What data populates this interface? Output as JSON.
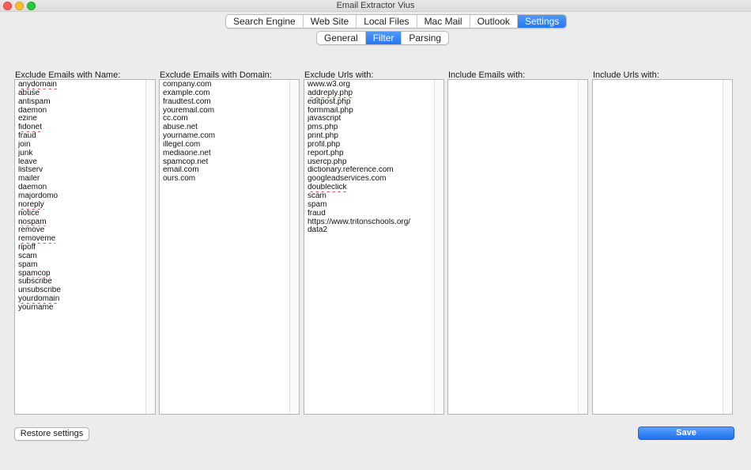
{
  "window": {
    "title": "Email Extractor Vius"
  },
  "main_tabs": [
    {
      "label": "Search Engine",
      "active": false
    },
    {
      "label": "Web Site",
      "active": false
    },
    {
      "label": "Local Files",
      "active": false
    },
    {
      "label": "Mac Mail",
      "active": false
    },
    {
      "label": "Outlook",
      "active": false
    },
    {
      "label": "Settings",
      "active": true
    }
  ],
  "sub_tabs": [
    {
      "label": "General",
      "active": false
    },
    {
      "label": "Filter",
      "active": true
    },
    {
      "label": "Parsing",
      "active": false
    }
  ],
  "columns": [
    {
      "label": "Exclude Emails with Name:",
      "items": [
        "anydomain",
        "abuse",
        "antispam",
        "daemon",
        "ezine",
        "fidonet",
        "fraud",
        "join",
        "junk",
        "leave",
        "listserv",
        "mailer",
        "daemon",
        "majordomo",
        "noreply",
        "notice",
        "nospam",
        "remove",
        "removeme",
        "ripoff",
        "scam",
        "spam",
        "spamcop",
        "subscribe",
        "unsubscribe",
        "yourdomain",
        "yourname"
      ],
      "spell_flagged": [
        "anydomain",
        "fidonet",
        "noreply",
        "nospam",
        "removeme",
        "spamcop",
        "yourdomain"
      ]
    },
    {
      "label": "Exclude Emails with Domain:",
      "items": [
        "company.com",
        "example.com",
        "fraudtest.com",
        "youremail.com",
        "cc.com",
        "abuse.net",
        "yourname.com",
        "illegel.com",
        "mediaone.net",
        "spamcop.net",
        "email.com",
        "ours.com"
      ],
      "spell_flagged": []
    },
    {
      "label": "Exclude Urls with:",
      "items": [
        "www.w3.org",
        "addreply.php",
        "editpost.php",
        "formmail.php",
        "javascript",
        "pms.php",
        "print.php",
        "profil.php",
        "report.php",
        "usercp.php",
        "dictionary.reference.com",
        "googleadservices.com",
        "doubleclick",
        "scam",
        "spam",
        "fraud",
        "https://www.tritonschools.org/",
        "data2"
      ],
      "spell_flagged": [
        "addreply.php",
        "doubleclick"
      ]
    },
    {
      "label": "Include Emails with:",
      "items": [],
      "spell_flagged": []
    },
    {
      "label": "Include Urls with:",
      "items": [],
      "spell_flagged": []
    }
  ],
  "buttons": {
    "restore_label": "Restore settings",
    "save_label": "Save"
  },
  "colors": {
    "accent": "#2476f5",
    "background": "#ececec",
    "spell_underline": "#e03a3a"
  }
}
